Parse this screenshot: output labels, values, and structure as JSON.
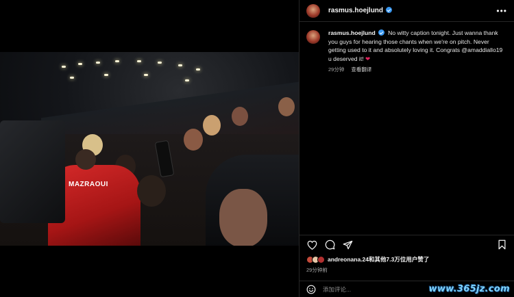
{
  "post": {
    "username": "rasmus.hoejlund",
    "caption_username": "rasmus.hoejlund",
    "caption_text": "No witty caption tonight. Just wanna thank you guys for hearing those chants when we're on pitch. Never getting used to it and absolutely loving it. Congrats @amaddiallo19 u deserved it! ",
    "caption_emoji": "❤",
    "caption_age": "29分钟",
    "translate_label": "查看翻译",
    "more_label": "•••"
  },
  "photo": {
    "shirt_text": "MAZRAOUI"
  },
  "likes": {
    "lead_user": "andreonana.24",
    "rest_text": "和其他7.3万位用户赞了"
  },
  "timestamp": "29分钟前",
  "comment": {
    "placeholder": "添加评论..."
  },
  "watermark": "www.365jz.com",
  "icons": [
    "heart-icon",
    "comment-icon",
    "share-icon",
    "bookmark-icon",
    "emoji-icon",
    "more-icon",
    "verified-badge-icon"
  ],
  "colors": {
    "background": "#000000",
    "verified": "#3897f0",
    "divider": "#262626",
    "muted": "#a8a8a8"
  }
}
